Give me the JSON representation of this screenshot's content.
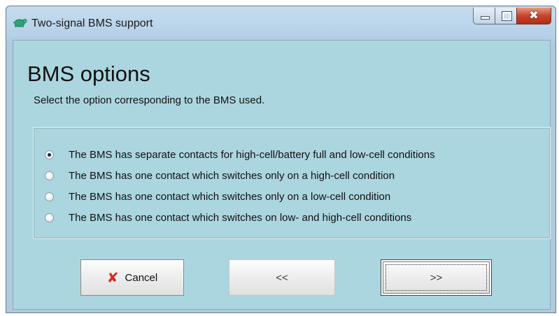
{
  "window": {
    "title": "Two-signal BMS support",
    "app_icon": "turtle-icon",
    "controls": {
      "minimize_icon": "minimize-icon",
      "maximize_icon": "maximize-icon",
      "close_glyph": "✖",
      "close_icon": "close-icon"
    }
  },
  "main": {
    "heading": "BMS options",
    "subheading": "Select the option corresponding to the BMS used.",
    "options": [
      {
        "label": "The BMS has separate contacts for high-cell/battery full and low-cell conditions",
        "selected": true
      },
      {
        "label": "The BMS has one contact which switches only on a high-cell condition",
        "selected": false
      },
      {
        "label": "The BMS has one contact which switches only on a low-cell condition",
        "selected": false
      },
      {
        "label": "The BMS has one contact which switches on low- and high-cell conditions",
        "selected": false
      }
    ]
  },
  "buttons": {
    "cancel_label": "Cancel",
    "cancel_icon": "x-icon",
    "cancel_glyph": "✘",
    "back_label": "<<",
    "next_label": ">>"
  },
  "colors": {
    "client_background": "#abd6df",
    "cancel_icon_color": "#d82a1f",
    "close_button_red": "#c7452c"
  }
}
